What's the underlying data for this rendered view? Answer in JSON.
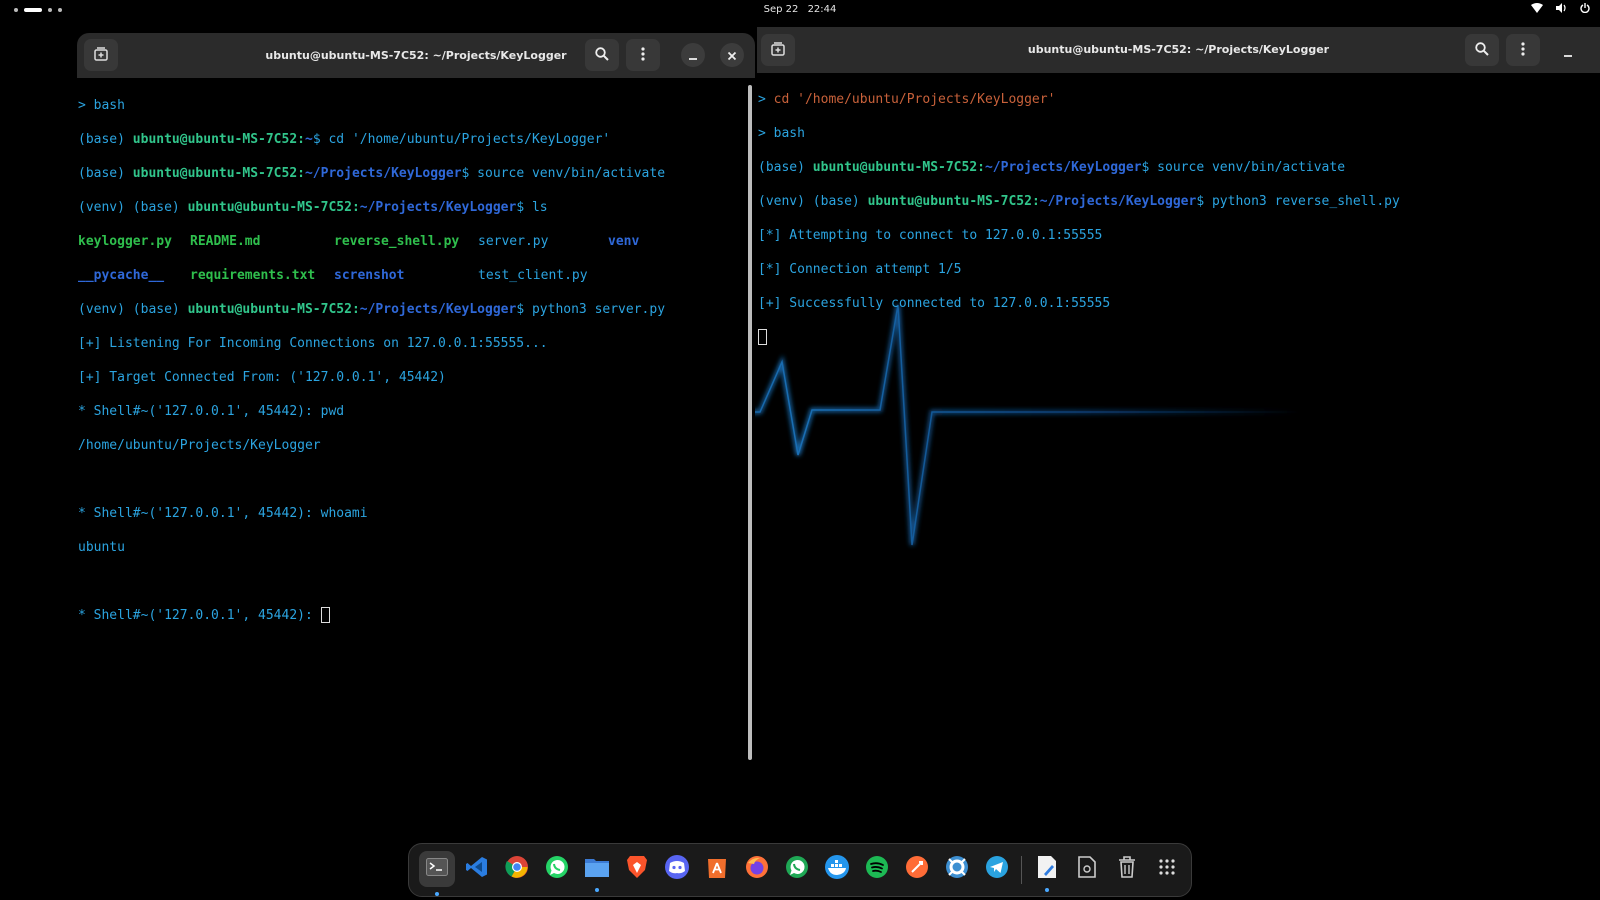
{
  "topbar": {
    "date": "Sep 22",
    "time": "22:44"
  },
  "left_window": {
    "title": "ubuntu@ubuntu-MS-7C52: ~/Projects/KeyLogger",
    "lines": {
      "l1": "> bash",
      "l2_pre": "(base) ",
      "l2_user": "ubuntu@ubuntu-MS-7C52:",
      "l2_path": "~",
      "l2_cmd": "$ cd '/home/ubuntu/Projects/KeyLogger'",
      "l3_pre": "(base) ",
      "l3_user": "ubuntu@ubuntu-MS-7C52:",
      "l3_path": "~/Projects/KeyLogger",
      "l3_cmd": "$ source venv/bin/activate",
      "l4_pre": "(venv) (base) ",
      "l4_user": "ubuntu@ubuntu-MS-7C52:",
      "l4_path": "~/Projects/KeyLogger",
      "l4_cmd": "$ ls",
      "ls": {
        "keylogger": "keylogger.py",
        "readme": "README.md",
        "reverse_shell": "reverse_shell.py",
        "server": "server.py",
        "venv": "venv",
        "pycache": "__pycache__",
        "requirements": "requirements.txt",
        "screnshot": "screnshot",
        "test_client": "test_client.py"
      },
      "l7_pre": "(venv) (base) ",
      "l7_user": "ubuntu@ubuntu-MS-7C52:",
      "l7_path": "~/Projects/KeyLogger",
      "l7_cmd": "$ python3 server.py",
      "l8": "[+] Listening For Incoming Connections on 127.0.0.1:55555...",
      "l9": "[+] Target Connected From: ('127.0.0.1', 45442)",
      "l10": "* Shell#~('127.0.0.1', 45442): pwd",
      "l11": "/home/ubuntu/Projects/KeyLogger",
      "l13": "* Shell#~('127.0.0.1', 45442): whoami",
      "l14": "ubuntu",
      "l16": "* Shell#~('127.0.0.1', 45442): "
    }
  },
  "right_window": {
    "title": "ubuntu@ubuntu-MS-7C52: ~/Projects/KeyLogger",
    "lines": {
      "r1_arrow": "> ",
      "r1_cmd": "cd '/home/ubuntu/Projects/KeyLogger'",
      "r2": "> bash",
      "r3_pre": "(base) ",
      "r3_user": "ubuntu@ubuntu-MS-7C52:",
      "r3_path": "~/Projects/KeyLogger",
      "r3_cmd": "$ source venv/bin/activate",
      "r4_pre": "(venv) (base) ",
      "r4_user": "ubuntu@ubuntu-MS-7C52:",
      "r4_path": "~/Projects/KeyLogger",
      "r4_cmd": "$ python3 reverse_shell.py",
      "r5": "[*] Attempting to connect to 127.0.0.1:55555",
      "r6": "[*] Connection attempt 1/5",
      "r7": "[+] Successfully connected to 127.0.0.1:55555"
    }
  },
  "dock": {
    "apps": [
      "terminal-icon",
      "vscode-icon",
      "chrome-icon",
      "whatsapp-icon",
      "files-icon",
      "brave-icon",
      "discord-icon",
      "app-center-icon",
      "firefox-icon",
      "whatsapp-alt-icon",
      "docker-icon",
      "spotify-icon",
      "postman-icon",
      "help-icon",
      "telegram-icon",
      "text-editor-icon",
      "document-viewer-icon",
      "trash-icon",
      "app-grid-icon"
    ],
    "colors": {
      "terminal": "#3a3a3a",
      "vscode": "#2a7de1",
      "whatsapp": "#25d366",
      "files": "#4a90e2",
      "brave": "#fb542b",
      "discord": "#5865f2",
      "firefox": "#ff7139",
      "docker": "#2496ed",
      "spotify": "#1db954",
      "postman": "#ff6c37",
      "telegram": "#2aa3e0",
      "running_dot": "#4aa8ff"
    }
  },
  "colors": {
    "terminal_text": "#2ba4e0",
    "user": "#31c58b",
    "path": "#2f68d8",
    "headerbar": "#2b2b2b",
    "heartbeat": "#1a6fb5"
  }
}
